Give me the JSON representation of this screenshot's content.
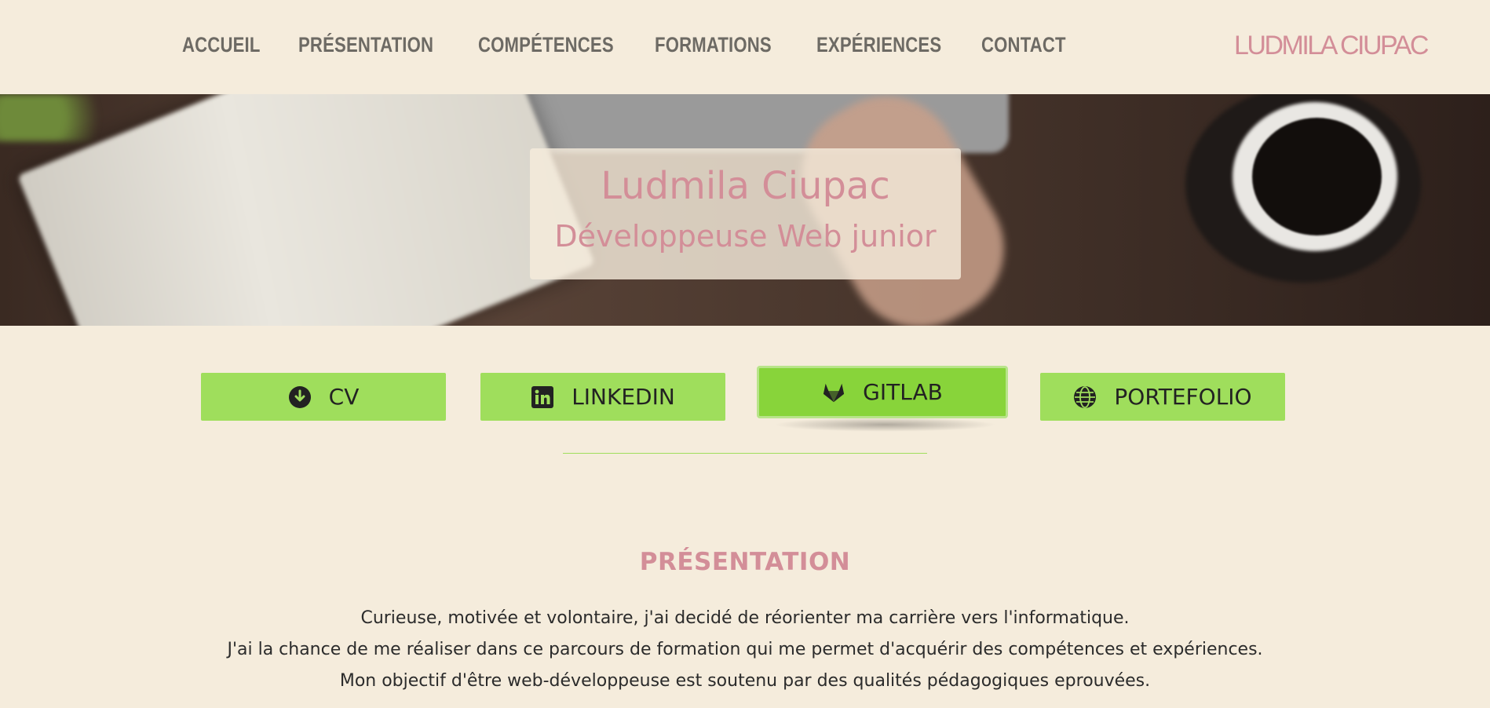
{
  "nav": {
    "items": [
      "ACCUEIL",
      "PRÉSENTATION",
      "COMPÉTENCES",
      "FORMATIONS",
      "EXPÉRIENCES",
      "CONTACT"
    ],
    "brand": "LUDMILA CIUPAC"
  },
  "hero": {
    "name": "Ludmila Ciupac",
    "role": "Développeuse Web junior"
  },
  "buttons": [
    {
      "label": "CV",
      "icon": "download-circle-icon"
    },
    {
      "label": "LINKEDIN",
      "icon": "linkedin-icon"
    },
    {
      "label": "GITLAB",
      "icon": "gitlab-icon"
    },
    {
      "label": "PORTEFOLIO",
      "icon": "globe-icon"
    }
  ],
  "presentation": {
    "title": "PRÉSENTATION",
    "lines": [
      "Curieuse, motivée et volontaire, j'ai decidé de réorienter ma carrière vers l'informatique.",
      "J'ai la chance de me réaliser dans ce parcours de formation qui me permet d'acquérir des compétences et expériences.",
      "Mon objectif d'être web-développeuse est soutenu par des qualités pédagogiques eprouvées."
    ]
  },
  "colors": {
    "background": "#f5ecdc",
    "accent_pink": "#d38e98",
    "button_green": "#9fde5c",
    "nav_text": "#6d6a64"
  }
}
